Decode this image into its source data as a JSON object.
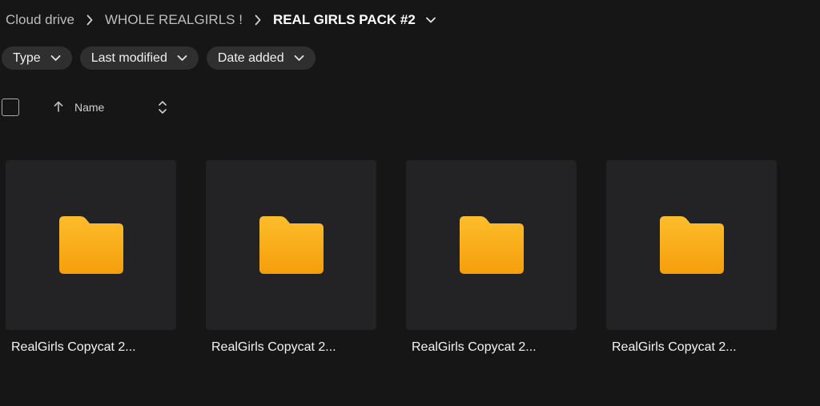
{
  "breadcrumb": {
    "items": [
      "Cloud drive",
      "WHOLE REALGIRLS !",
      "REAL GIRLS PACK #2"
    ]
  },
  "filters": [
    {
      "label": "Type"
    },
    {
      "label": "Last modified"
    },
    {
      "label": "Date added"
    }
  ],
  "sort": {
    "label": "Name",
    "direction": "ascending"
  },
  "folders": [
    {
      "name": "RealGirls Copycat 2..."
    },
    {
      "name": "RealGirls Copycat 2..."
    },
    {
      "name": "RealGirls Copycat 2..."
    },
    {
      "name": "RealGirls Copycat 2..."
    }
  ],
  "colors": {
    "background": "#161616",
    "tile": "#232325",
    "chip": "#2f2f2f",
    "folder_top": "#fdbd2b",
    "folder_bottom": "#f59e0b"
  },
  "icons": [
    "chevron-right-icon",
    "chevron-down-icon",
    "arrow-up-icon",
    "sort-toggle-icon",
    "folder-icon"
  ]
}
